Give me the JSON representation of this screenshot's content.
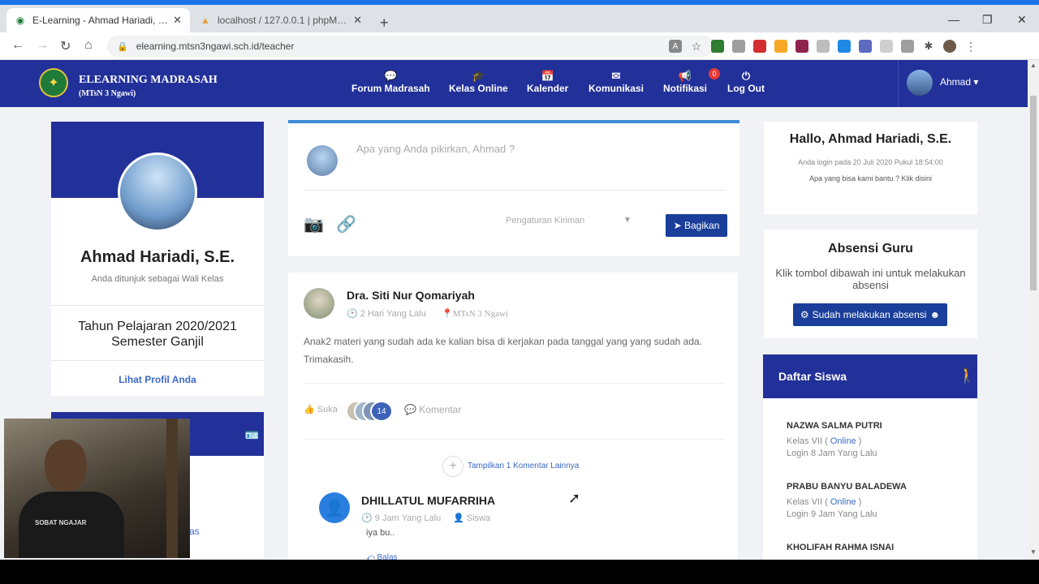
{
  "browser": {
    "tabs": [
      {
        "title": "E-Learning - Ahmad Hariadi, S.E.",
        "active": true
      },
      {
        "title": "localhost / 127.0.0.1 | phpMyAdmin",
        "active": false
      }
    ],
    "url": "elearning.mtsn3ngawi.sch.id/teacher",
    "accent": "#1a73e8"
  },
  "site": {
    "brand": "ELEARNING MADRASAH",
    "brand_sub": "(MTsN 3 Ngawi)",
    "nav": [
      {
        "label": "Forum Madrasah",
        "icon": "chat-icon"
      },
      {
        "label": "Kelas Online",
        "icon": "graduation-cap-icon"
      },
      {
        "label": "Kalender",
        "icon": "calendar-icon"
      },
      {
        "label": "Komunikasi",
        "icon": "envelope-icon"
      },
      {
        "label": "Notifikasi",
        "icon": "megaphone-icon",
        "badge": "0"
      },
      {
        "label": "Log Out",
        "icon": "power-icon"
      }
    ],
    "user": "Ahmad",
    "primary": "#22309a"
  },
  "profile": {
    "name": "Ahmad Hariadi, S.E.",
    "role": "Anda ditunjuk sebagai Wali Kelas",
    "year": "Tahun Pelajaran 2020/2021",
    "term": "Semester Ganjil",
    "link": "Lihat Profil Anda",
    "snippet": "as"
  },
  "composer": {
    "placeholder": "Apa yang Anda pikirkan, Ahmad  ?",
    "setting": "Pengaturan Kiriman",
    "share": "Bagikan"
  },
  "post": {
    "author": "Dra. Siti Nur Qomariyah",
    "time": "2 Hari Yang Lalu",
    "place": "MTsN 3 Ngawi",
    "text": "Anak2 materi yang sudah ada ke kalian bisa di kerjakan pada tanggal yang yang sudah ada. Trimakasih.",
    "like": "Suka",
    "like_count": "14",
    "comment": "Komentar",
    "more": "Tampilkan 1 Komentar Lainnya"
  },
  "comment": {
    "name": "DHILLATUL MUFARRIHA",
    "time": "9 Jam Yang Lalu",
    "role": "Siswa",
    "text": "iya bu..",
    "reply": "Balas"
  },
  "sidebar": {
    "hello": "Hallo, Ahmad Hariadi, S.E.",
    "login_info": "Anda login pada 20 Juli 2020 Pukul 18:54:00",
    "help": "Apa yang bisa kami bantu ? Klik disini",
    "absen_title": "Absensi Guru",
    "absen_desc": "Klik tombol dibawah ini untuk melakukan absensi",
    "absen_btn": "Sudah melakukan absensi",
    "ds_title": "Daftar Siswa",
    "students": [
      {
        "name": "NAZWA SALMA PUTRI",
        "class": "Kelas VII (",
        "status": "Online",
        "close": " )",
        "login": "Login 8 Jam Yang Lalu"
      },
      {
        "name": "PRABU BANYU BALADEWA",
        "class": "Kelas VII (",
        "status": "Online",
        "close": " )",
        "login": "Login 9 Jam Yang Lalu"
      },
      {
        "name": "KHOLIFAH RAHMA ISNAI",
        "class": "",
        "status": "",
        "close": "",
        "login": ""
      }
    ]
  },
  "webcam": {
    "shirt_text": "SOBAT NGAJAR"
  }
}
